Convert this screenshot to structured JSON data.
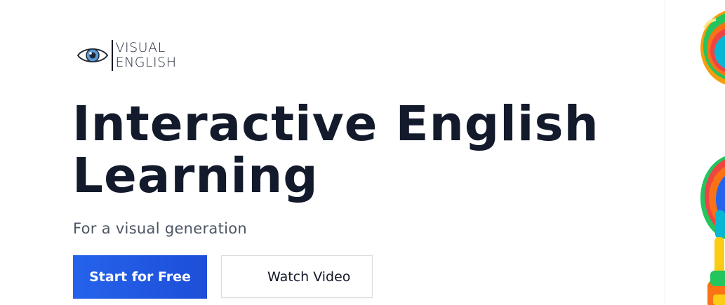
{
  "logo": {
    "line1": "VISUAL",
    "line2": "ENGLISH",
    "icon": "eye-icon"
  },
  "hero": {
    "title_line1": "Interactive English",
    "title_line2": "Learning",
    "subtitle": "For a visual generation"
  },
  "buttons": {
    "primary_label": "Start for Free",
    "secondary_label": "Watch Video"
  },
  "colors": {
    "primary": "#2563eb",
    "headline": "#121a2b",
    "subtitle": "#4b5563"
  }
}
